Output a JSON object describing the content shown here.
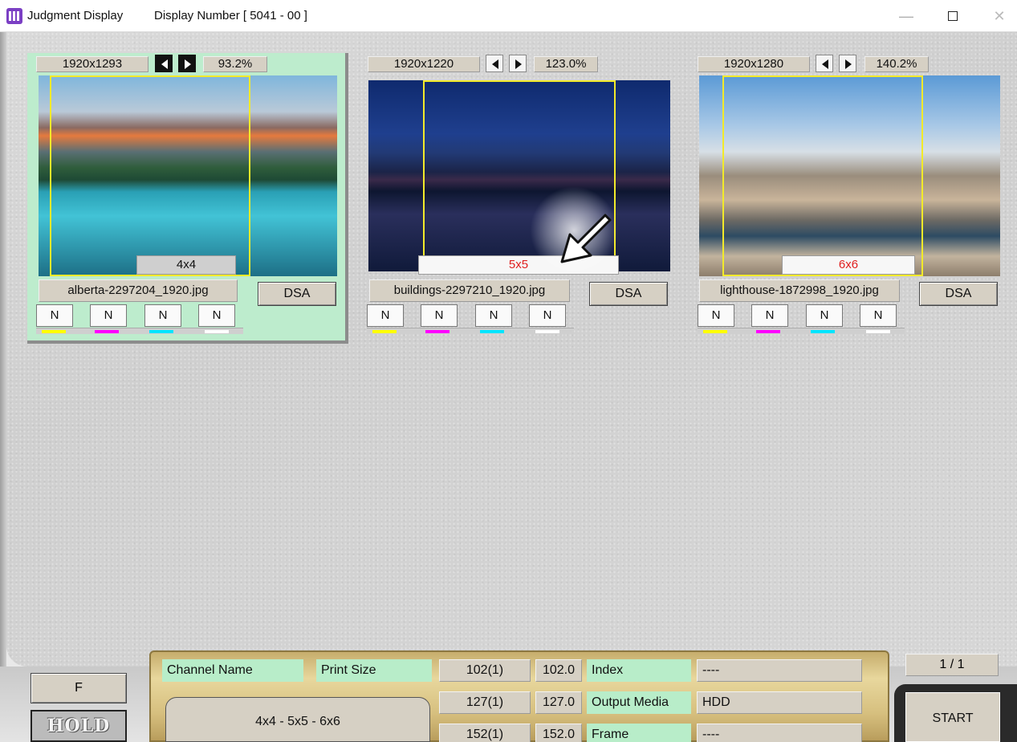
{
  "window": {
    "title": "Judgment Display",
    "display_number": "Display Number [ 5041 - 00 ]",
    "min_glyph": "—",
    "close_glyph": "✕"
  },
  "images": [
    {
      "resolution": "1920x1293",
      "zoom": "93.2%",
      "print_size": "4x4",
      "filename": "alberta-2297204_1920.jpg",
      "dsa_label": "DSA",
      "channels": [
        "N",
        "N",
        "N",
        "N"
      ],
      "selected": true
    },
    {
      "resolution": "1920x1220",
      "zoom": "123.0%",
      "print_size": "5x5",
      "filename": "buildings-2297210_1920.jpg",
      "dsa_label": "DSA",
      "channels": [
        "N",
        "N",
        "N",
        "N"
      ],
      "selected": false
    },
    {
      "resolution": "1920x1280",
      "zoom": "140.2%",
      "print_size": "6x6",
      "filename": "lighthouse-1872998_1920.jpg",
      "dsa_label": "DSA",
      "channels": [
        "N",
        "N",
        "N",
        "N"
      ],
      "selected": false
    }
  ],
  "channel_colors": [
    "#ffff00",
    "#ff00ff",
    "#00e5ff",
    "#ffffff"
  ],
  "controls": {
    "f_label": "F",
    "hold_label": "HOLD",
    "channel_name_label": "Channel Name",
    "print_size_label": "Print Size",
    "print_sizes_combined": "4x4 - 5x5 - 6x6",
    "size_counts": [
      "102(1)",
      "127(1)",
      "152(1)"
    ],
    "size_values": [
      "102.0",
      "127.0",
      "152.0"
    ],
    "index_label": "Index",
    "index_value": "----",
    "output_media_label": "Output Media",
    "output_media_value": "HDD",
    "frame_label": "Frame",
    "frame_value": "----",
    "page": "1 / 1",
    "start_label": "START"
  }
}
